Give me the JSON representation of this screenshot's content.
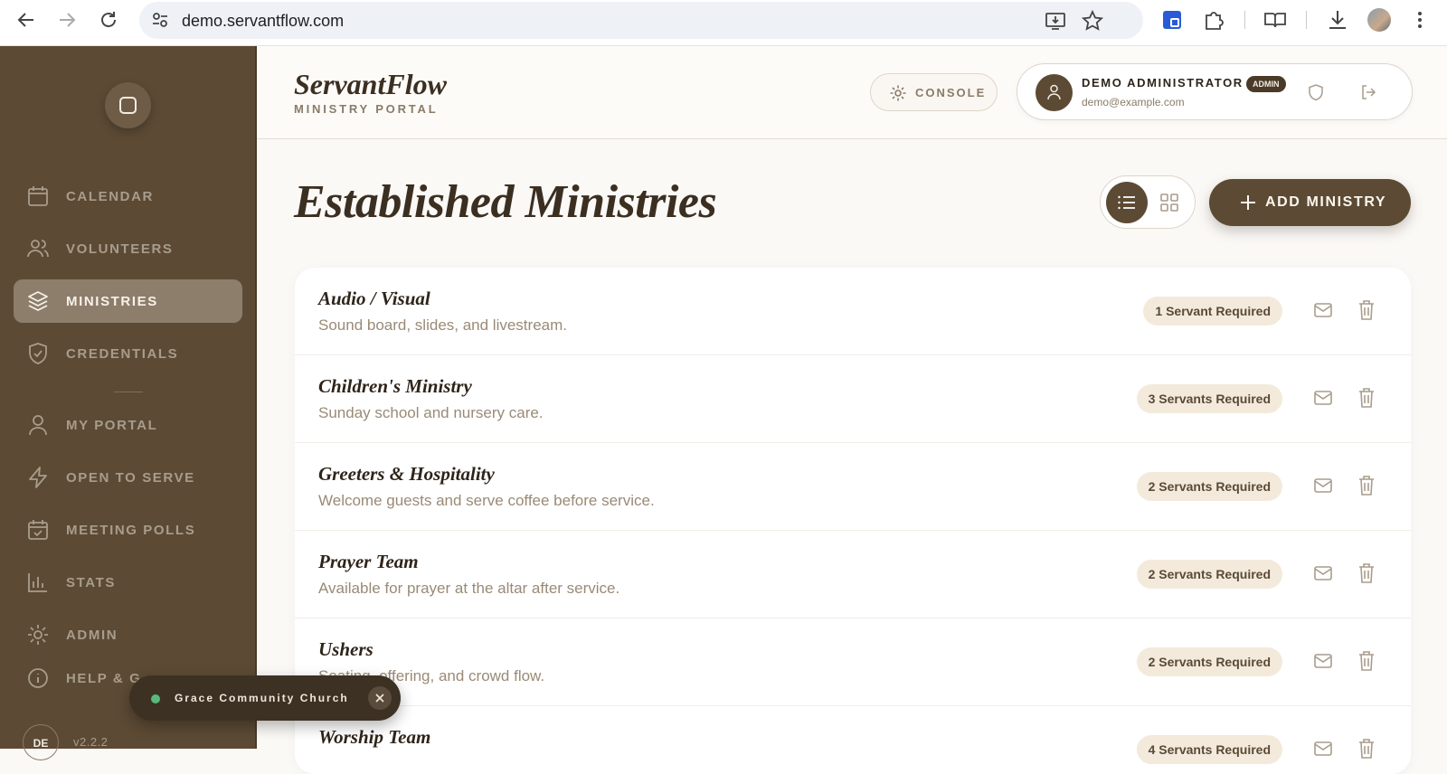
{
  "browser": {
    "url": "demo.servantflow.com"
  },
  "sidebar": {
    "items": [
      {
        "label": "CALENDAR",
        "icon": "calendar-icon",
        "active": false
      },
      {
        "label": "VOLUNTEERS",
        "icon": "users-icon",
        "active": false
      },
      {
        "label": "MINISTRIES",
        "icon": "layers-icon",
        "active": true
      },
      {
        "label": "CREDENTIALS",
        "icon": "shield-check-icon",
        "active": false
      },
      {
        "label": "MY PORTAL",
        "icon": "user-icon",
        "active": false
      },
      {
        "label": "OPEN TO SERVE",
        "icon": "lightning-icon",
        "active": false
      },
      {
        "label": "MEETING POLLS",
        "icon": "calendar-check-icon",
        "active": false
      },
      {
        "label": "STATS",
        "icon": "bar-chart-icon",
        "active": false
      },
      {
        "label": "ADMIN",
        "icon": "gear-icon",
        "active": false
      },
      {
        "label": "HELP & G",
        "icon": "info-icon",
        "active": false
      }
    ],
    "user_initials": "DE",
    "version": "v2.2.2"
  },
  "header": {
    "brand": "ServantFlow",
    "brand_sub": "MINISTRY PORTAL",
    "console_label": "CONSOLE",
    "user_name": "DEMO ADMINISTRATOR",
    "user_badge": "ADMIN",
    "user_email": "demo@example.com"
  },
  "main": {
    "title": "Established Ministries",
    "add_label": "ADD MINISTRY",
    "ministries": [
      {
        "name": "Audio / Visual",
        "desc": "Sound board, slides, and livestream.",
        "required": "1 Servant Required"
      },
      {
        "name": "Children's Ministry",
        "desc": "Sunday school and nursery care.",
        "required": "3 Servants Required"
      },
      {
        "name": "Greeters & Hospitality",
        "desc": "Welcome guests and serve coffee before service.",
        "required": "2 Servants Required"
      },
      {
        "name": "Prayer Team",
        "desc": "Available for prayer at the altar after service.",
        "required": "2 Servants Required"
      },
      {
        "name": "Ushers",
        "desc": "Seating, offering, and crowd flow.",
        "required": "2 Servants Required"
      },
      {
        "name": "Worship Team",
        "desc": "",
        "required": "4 Servants Required"
      }
    ]
  },
  "toast": {
    "label": "Grace Community Church"
  },
  "colors": {
    "sidebar": "#5c4a34",
    "accent": "#5c4a34",
    "pill": "#f3eadc",
    "status_dot": "#59b97b"
  }
}
